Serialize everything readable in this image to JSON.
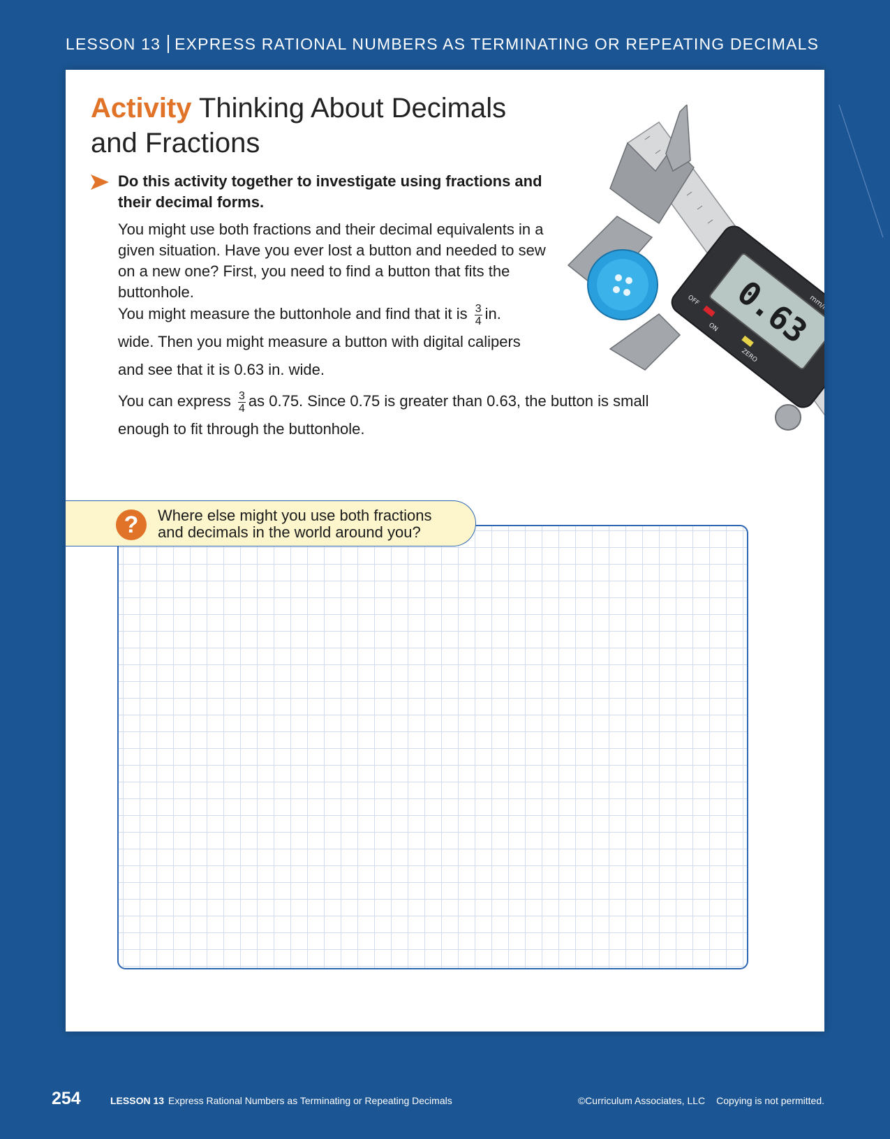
{
  "header": {
    "lesson": "LESSON 13",
    "title": "EXPRESS RATIONAL NUMBERS AS TERMINATING OR REPEATING DECIMALS"
  },
  "activity": {
    "label": "Activity",
    "title_line1": "Thinking About Decimals",
    "title_line2": "and Fractions",
    "lead": "Do this activity together to investigate using fractions and their decimal forms.",
    "p1": "You might use both fractions and their decimal equivalents in a given situation. Have you ever lost a button and needed to sew on a new one? First, you need to find a button that fits the buttonhole.",
    "p2_a": "You might measure the buttonhole and find that it is",
    "p2_num": "3",
    "p2_den": "4",
    "p2_b": "in.",
    "p2_c": "wide. Then you might measure a button with digital calipers",
    "p2_d": "and see that it is 0.63 in. wide.",
    "p3_a": "You can express",
    "p3_num": "3",
    "p3_den": "4",
    "p3_b": "as 0.75. Since 0.75 is greater than 0.63, the button is small",
    "p3_c": "enough to fit through the buttonhole."
  },
  "photo": {
    "display": "0.63",
    "unit_label": "mm/inch",
    "off_label": "OFF",
    "on_label": "ON",
    "zero_label": "ZERO",
    "icon": "digital-caliper-with-button"
  },
  "question": {
    "icon": "question-mark-icon",
    "line1": "Where else might you use both fractions",
    "line2": "and decimals in the world around you?"
  },
  "footer": {
    "page": "254",
    "lesson_label": "LESSON 13",
    "lesson_title": "Express Rational Numbers as Terminating or Repeating Decimals",
    "copyright": "©Curriculum Associates, LLC",
    "notice": "Copying is not permitted."
  },
  "colors": {
    "background": "#1b5593",
    "accent": "#e07327",
    "grid_border": "#2d66b2",
    "question_fill": "#fdf6cc"
  }
}
